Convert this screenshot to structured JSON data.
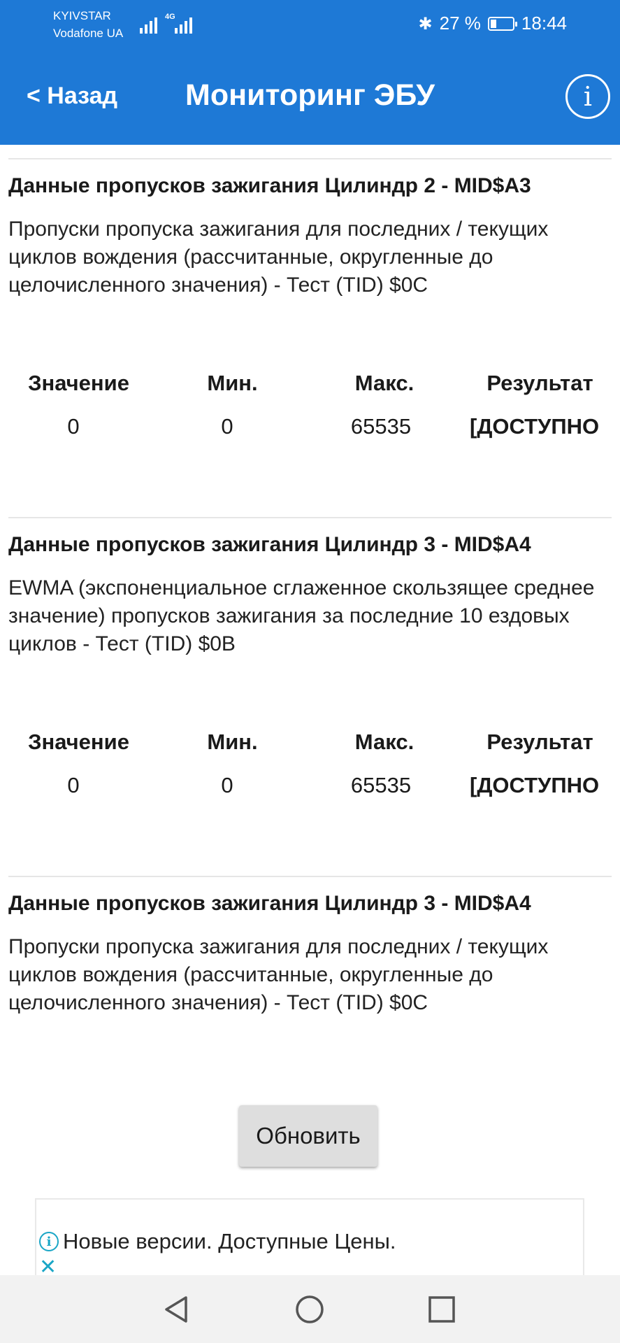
{
  "status_bar": {
    "carrier1": "KYIVSTAR",
    "carrier2": "Vodafone UA",
    "network": "4G",
    "battery_text": "27 %",
    "battery_level": 0.27,
    "time": "18:44"
  },
  "header": {
    "back_label": "< Назад",
    "title": "Мониторинг ЭБУ",
    "info_icon": "info-icon"
  },
  "table_headers": {
    "value": "Значение",
    "min": "Мин.",
    "max": "Макс.",
    "result": "Результат"
  },
  "sections": [
    {
      "title": "Данные пропусков зажигания Цилиндр 2 - MID$A3",
      "description": "Пропуски пропуска зажигания для последних / текущих циклов вождения (рассчитанные, округленные до целочисленного значения) - Тест (TID) $0C",
      "value": "0",
      "min": "0",
      "max": "65535",
      "result": "[ДОСТУПНО"
    },
    {
      "title": "Данные пропусков зажигания Цилиндр 3 - MID$A4",
      "description": "EWMA (экспоненциальное сглаженное скользящее среднее значение) пропусков зажигания за последние 10 ездовых циклов - Тест (TID) $0B",
      "value": "0",
      "min": "0",
      "max": "65535",
      "result": "[ДОСТУПНО"
    },
    {
      "title": "Данные пропусков зажигания Цилиндр 3 - MID$A4",
      "description": "Пропуски пропуска зажигания для последних / текущих циклов вождения (рассчитанные, округленные до целочисленного значения) - Тест (TID) $0C"
    }
  ],
  "refresh_label": "Обновить",
  "ad": {
    "text": "Новые версии. Доступные Цены.",
    "info_icon": "ad-info-icon",
    "close_icon": "ad-close-icon"
  },
  "nav_bar": {
    "back_icon": "nav-back-icon",
    "home_icon": "nav-home-icon",
    "recents_icon": "nav-recents-icon"
  }
}
